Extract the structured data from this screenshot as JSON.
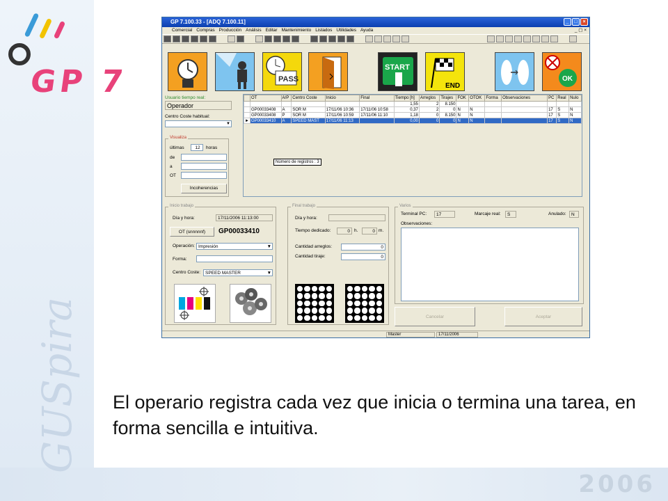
{
  "caption": "El operario registra cada vez que inicia o termina una tarea, en forma sencilla e intuitiva.",
  "branding": {
    "product": "GP 7",
    "company": "GUSpira",
    "year": "2006"
  },
  "window": {
    "title": "GP 7.100.33 - [ADQ   7.100.11]",
    "menu": [
      "Comercial",
      "Compras",
      "Producción",
      "Análisis",
      "Editar",
      "Mantenimiento",
      "Listados",
      "Utilidades",
      "Ayuda"
    ]
  },
  "big_icons": [
    "clock-icon",
    "operator-icon",
    "pass-icon",
    "door-icon",
    "start-icon",
    "end-flag-icon",
    "swap-icon",
    "ok-icon"
  ],
  "big_icon_text": {
    "pass": "PASS",
    "start": "START",
    "end": "END",
    "ok": "OK"
  },
  "left": {
    "user_label": "Usuario tiempo real:",
    "user_value": "Operador",
    "cost_center_label": "Centro Coste habitual:",
    "visualiza_title": "Visualiza",
    "ultimas_label": "últimas",
    "ultimas_value": "12",
    "horas_label": "horas",
    "de_label": "de",
    "a_label": "a",
    "ot_label": "OT",
    "incoherencias_button": "Incoherencias"
  },
  "grid": {
    "headers": [
      "OT",
      "A/P",
      "Centro Coste",
      "Inicio",
      "Final",
      "Tiempo [h]",
      "Arreglos",
      "Tirajes",
      "FOK",
      "OTOK",
      "Forma",
      "Observaciones",
      "PC",
      "Real",
      "Nulo"
    ],
    "rows": [
      [
        "",
        "",
        "",
        "",
        "",
        "1,55",
        "2",
        "8.150",
        "",
        "",
        "",
        "",
        "",
        "",
        ""
      ],
      [
        "GP00033408",
        "A",
        "SOR M",
        "17/11/06 10:36",
        "17/11/06 10:58",
        "0,37",
        "2",
        "0",
        "N",
        "N",
        "",
        "",
        "17",
        "S",
        "N"
      ],
      [
        "GP00033408",
        "P",
        "SOR M",
        "17/11/06 10:59",
        "17/11/06 11:10",
        "1,18",
        "0",
        "8.150",
        "N",
        "N",
        "",
        "",
        "17",
        "S",
        "N"
      ],
      [
        "GP00033410",
        "A",
        "SPEED MAST",
        "17/11/06 11:13",
        "",
        "0,00",
        "0",
        "0",
        "N",
        "N",
        "",
        "",
        "17",
        "S",
        "N"
      ]
    ],
    "record_count": "Número de registros : 3"
  },
  "inicio": {
    "title": "Inicio trabajo",
    "dia_hora_label": "Día y hora:",
    "dia_hora_value": "17/11/2006 11:13:00",
    "ot_button": "OT (snnnnnf)",
    "ot_value": "GP00033410",
    "operacion_label": "Operación:",
    "operacion_value": "Impresión",
    "forma_label": "Forma:",
    "centro_label": "Centro Coste:",
    "centro_value": "SPEED MASTER"
  },
  "final": {
    "title": "Final trabajo",
    "dia_hora_label": "Día y hora:",
    "tiempo_label": "Tiempo dedicado:",
    "tiempo_h": "0",
    "h_label": "h.",
    "tiempo_m": "0",
    "m_label": "m.",
    "arreglos_label": "Cantidad arreglos:",
    "arreglos_value": "0",
    "tiraje_label": "Cantidad tiraje:",
    "tiraje_value": "0"
  },
  "varios": {
    "title": "Varios",
    "terminal_label": "Terminal PC:",
    "terminal_value": "17",
    "marcaje_label": "Marcaje real:",
    "marcaje_value": "S",
    "anulado_label": "Anulado:",
    "anulado_value": "N",
    "observaciones_label": "Observaciones:",
    "cancelar_button": "Cancelar",
    "aceptar_button": "Aceptar"
  },
  "status": {
    "user": "Master",
    "date": "17/11/2006"
  }
}
